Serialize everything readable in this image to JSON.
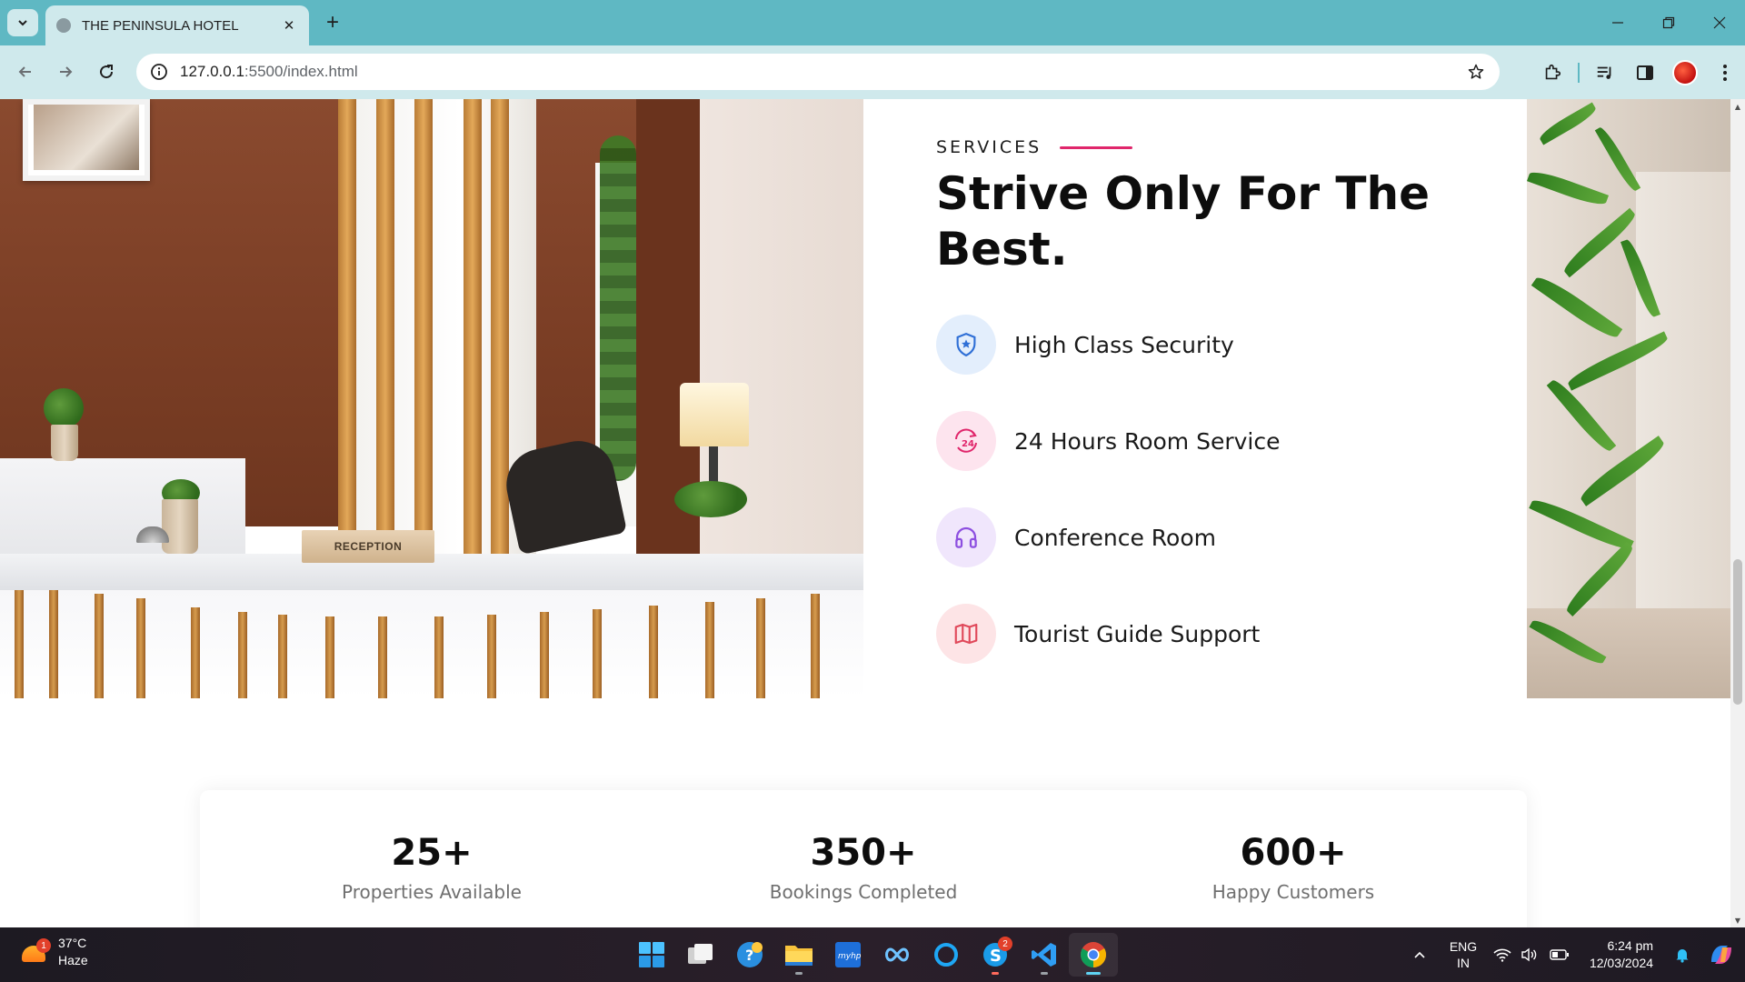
{
  "browser": {
    "tab_title": "THE PENINSULA HOTEL",
    "url_host": "127.0.0.1",
    "url_path": ":5500/index.html",
    "accent_color": "#5fb8c3"
  },
  "services": {
    "eyebrow": "SERVICES",
    "title": "Strive Only For The Best.",
    "accent_color": "#e0266b",
    "items": [
      {
        "label": "High Class Security",
        "icon": "shield-star-icon",
        "color": "#2f6fd6",
        "bg": "#e3eefc"
      },
      {
        "label": "24 Hours Room Service",
        "icon": "24-hours-icon",
        "color": "#e0266b",
        "bg": "#fde4ee"
      },
      {
        "label": "Conference Room",
        "icon": "headphones-icon",
        "color": "#8d4fe0",
        "bg": "#f0e6fc"
      },
      {
        "label": "Tourist Guide Support",
        "icon": "map-icon",
        "color": "#e0485a",
        "bg": "#fde4e6"
      }
    ]
  },
  "reception_image": {
    "sign_text": "RECEPTION"
  },
  "stats": [
    {
      "number": "25+",
      "label": "Properties Available"
    },
    {
      "number": "350+",
      "label": "Bookings Completed"
    },
    {
      "number": "600+",
      "label": "Happy Customers"
    }
  ],
  "taskbar": {
    "weather_temp": "37°C",
    "weather_desc": "Haze",
    "weather_badge": "1",
    "skype_badge": "2",
    "lang_line1": "ENG",
    "lang_line2": "IN",
    "time": "6:24 pm",
    "date": "12/03/2024"
  }
}
